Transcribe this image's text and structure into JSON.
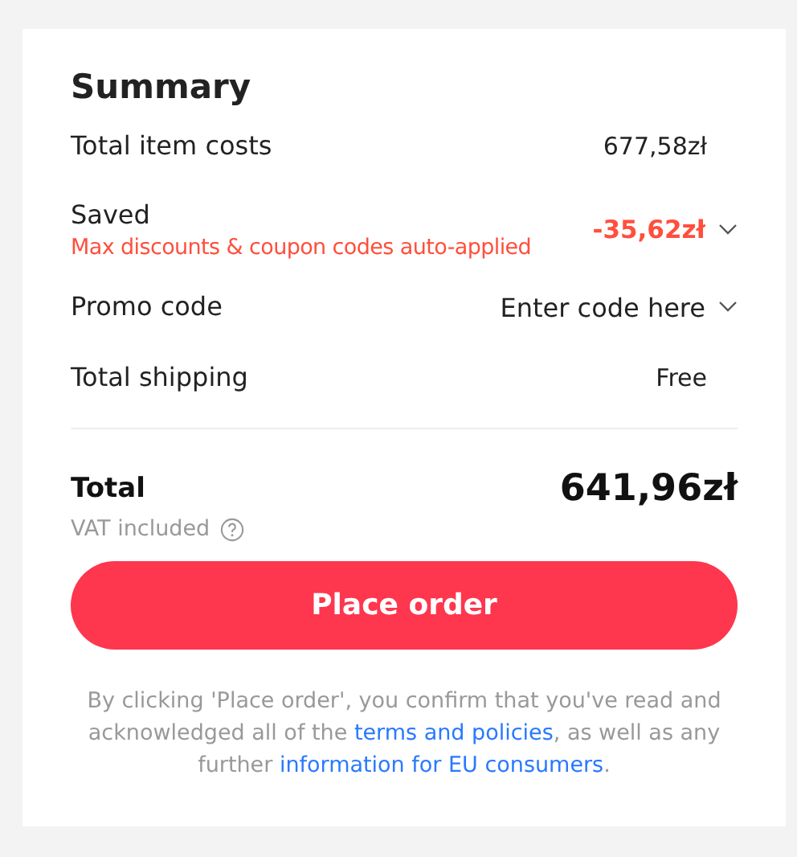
{
  "summary": {
    "title": "Summary",
    "rows": [
      {
        "kind": "amount",
        "label": "Total item costs",
        "value": "677,58zł"
      },
      {
        "kind": "discount",
        "label": "Saved",
        "note": "Max discounts & coupon codes auto-applied",
        "value": "-35,62zł",
        "expanded": false
      },
      {
        "kind": "promo",
        "label": "Promo code",
        "placeholder": "Enter code here",
        "expanded": false
      },
      {
        "kind": "amount",
        "label": "Total shipping",
        "value": "Free"
      }
    ],
    "total": {
      "label": "Total",
      "value": "641,96zł",
      "vat_note": "VAT included"
    },
    "button": "Place order",
    "disclaimer": [
      {
        "kind": "text",
        "text": "By clicking 'Place order', you confirm that you've read and acknowledged all of the "
      },
      {
        "kind": "link",
        "text": "terms and policies"
      },
      {
        "kind": "text",
        "text": ", as well as any further "
      },
      {
        "kind": "link",
        "text": "information for EU consumers"
      },
      {
        "kind": "text",
        "text": "."
      }
    ]
  }
}
